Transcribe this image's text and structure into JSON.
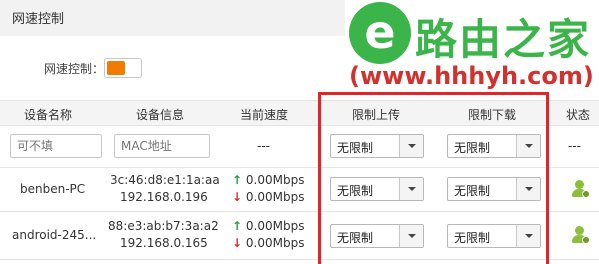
{
  "panel": {
    "title": "网速控制"
  },
  "watermark": {
    "brand_text": "路由之家",
    "url_text": "(www.hhhyh.com)",
    "logo_letter": "e"
  },
  "speed_control": {
    "label": "网速控制：",
    "enabled": true,
    "accent_color": "#f07b00"
  },
  "table": {
    "headers": [
      "设备名称",
      "设备信息",
      "当前速度",
      "限制上传",
      "限制下载",
      "状态"
    ],
    "filter_row": {
      "name_placeholder": "可不填",
      "mac_placeholder": "MAC地址",
      "speed": "---",
      "upload": "无限制",
      "download": "无限制",
      "status": "---"
    },
    "devices": [
      {
        "name": "benben-PC",
        "mac": "3c:46:d8:e1:1a:aa",
        "ip": "192.168.0.196",
        "up": "0.00Mbps",
        "down": "0.00Mbps",
        "upload": "无限制",
        "download": "无限制",
        "status_icon": "user-online-icon"
      },
      {
        "name": "android-245...",
        "mac": "88:e3:ab:b7:3a:a2",
        "ip": "192.168.0.165",
        "up": "0.00Mbps",
        "down": "0.00Mbps",
        "upload": "无限制",
        "download": "无限制",
        "status_icon": "user-online-icon"
      }
    ]
  },
  "arrows": {
    "up": "↑",
    "down": "↓"
  },
  "colors": {
    "highlight_border": "#e0262b",
    "up_arrow": "#2e9e3a",
    "down_arrow": "#d2322d",
    "brand_green": "#3bb54a"
  }
}
